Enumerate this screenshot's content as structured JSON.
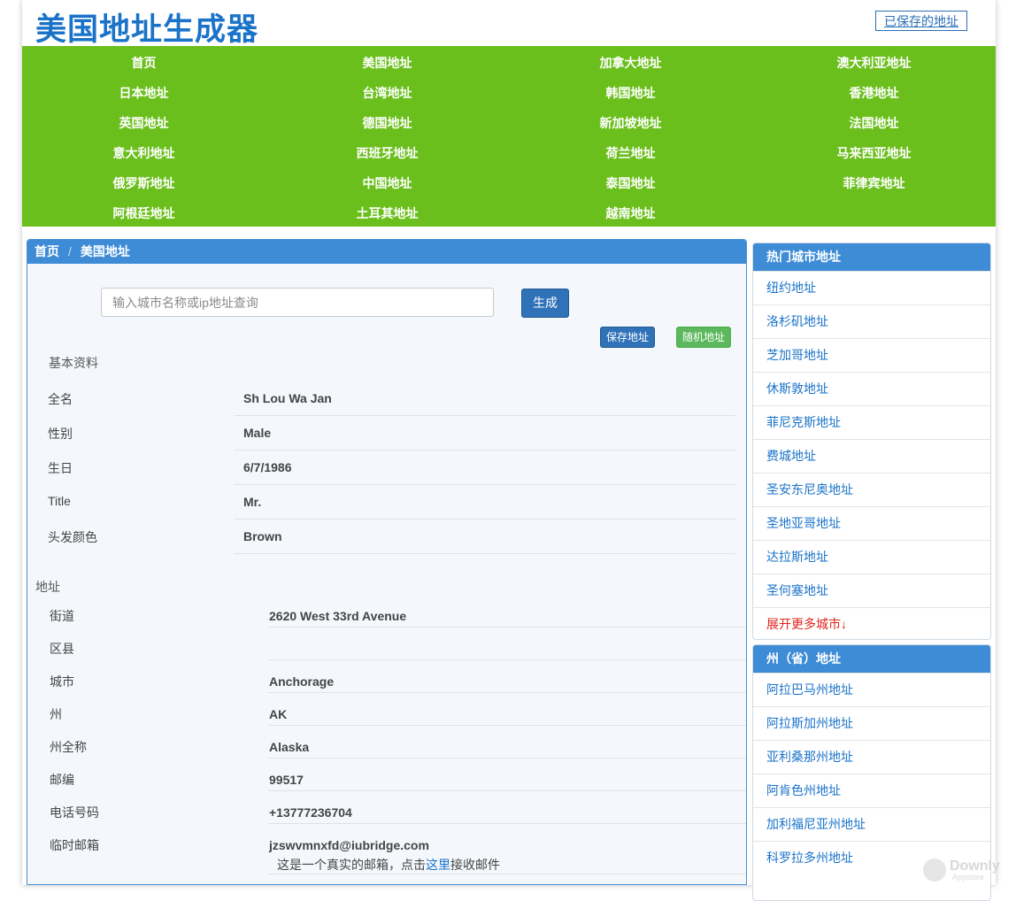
{
  "header": {
    "title": "美国地址生成器",
    "saved_link": "已保存的地址"
  },
  "nav": {
    "items": [
      "首页",
      "美国地址",
      "加拿大地址",
      "澳大利亚地址",
      "日本地址",
      "台湾地址",
      "韩国地址",
      "香港地址",
      "英国地址",
      "德国地址",
      "新加坡地址",
      "法国地址",
      "意大利地址",
      "西班牙地址",
      "荷兰地址",
      "马来西亚地址",
      "俄罗斯地址",
      "中国地址",
      "泰国地址",
      "菲律宾地址",
      "阿根廷地址",
      "土耳其地址",
      "越南地址"
    ]
  },
  "breadcrumb": {
    "home": "首页",
    "separator": "/",
    "current": "美国地址"
  },
  "search": {
    "placeholder": "输入城市名称或ip地址查询",
    "value": "",
    "button": "生成"
  },
  "actions": {
    "save": "保存地址",
    "random": "随机地址"
  },
  "basic": {
    "title": "基本资料",
    "rows": [
      {
        "label": "全名",
        "value": "Sh Lou Wa Jan"
      },
      {
        "label": "性别",
        "value": "Male"
      },
      {
        "label": "生日",
        "value": "6/7/1986"
      },
      {
        "label": "Title",
        "value": "Mr."
      },
      {
        "label": "头发颜色",
        "value": "Brown"
      }
    ]
  },
  "address": {
    "title": "地址",
    "rows": [
      {
        "label": "街道",
        "value": "2620 West 33rd Avenue"
      },
      {
        "label": "区县",
        "value": ""
      },
      {
        "label": "城市",
        "value": "Anchorage"
      },
      {
        "label": "州",
        "value": "AK"
      },
      {
        "label": "州全称",
        "value": "Alaska"
      },
      {
        "label": "邮编",
        "value": "99517"
      },
      {
        "label": "电话号码",
        "value": "+13777236704"
      },
      {
        "label": "临时邮箱",
        "value": "jzswvmnxfd@iubridge.com"
      }
    ],
    "email_hint_prefix": "这是一个真实的邮箱，点击",
    "email_hint_link": "这里",
    "email_hint_suffix": "接收邮件"
  },
  "hot_cities": {
    "title": "热门城市地址",
    "items": [
      "纽约地址",
      "洛杉矶地址",
      "芝加哥地址",
      "休斯敦地址",
      "菲尼克斯地址",
      "费城地址",
      "圣安东尼奥地址",
      "圣地亚哥地址",
      "达拉斯地址",
      "圣何塞地址"
    ],
    "more": "展开更多城市↓"
  },
  "states": {
    "title": "州（省）地址",
    "items": [
      "阿拉巴马州地址",
      "阿拉斯加州地址",
      "亚利桑那州地址",
      "阿肯色州地址",
      "加利福尼亚州地址",
      "科罗拉多州地址"
    ]
  },
  "watermark": {
    "name": "Downly",
    "sub": "Appstore"
  },
  "colors": {
    "nav_green": "#6bbf1c",
    "primary_blue": "#3e8cd6",
    "link_blue": "#1a73c9",
    "more_red": "#e0241b"
  }
}
